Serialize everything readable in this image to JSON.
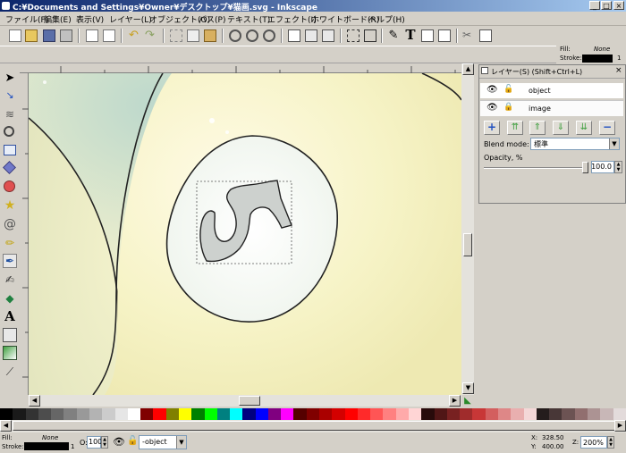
{
  "window": {
    "title": "C:¥Documents and Settings¥Owner¥デスクトップ¥猫画.svg - Inkscape"
  },
  "menu": [
    {
      "label": "ファイル(F)"
    },
    {
      "label": "編集(E)"
    },
    {
      "label": "表示(V)"
    },
    {
      "label": "レイヤー(L)"
    },
    {
      "label": "オブジェクト(O)"
    },
    {
      "label": "パス(P)"
    },
    {
      "label": "テキスト(T)"
    },
    {
      "label": "エフェクト(I)"
    },
    {
      "label": "ホワイトボード(R)"
    },
    {
      "label": "ヘルプ(H)"
    }
  ],
  "top_style": {
    "fill_label": "Fill:",
    "fill_value": "None",
    "stroke_label": "Stroke:",
    "stroke_width": "1"
  },
  "layers_panel": {
    "title": "レイヤー(S) (Shift+Ctrl+L)",
    "layers": [
      {
        "name": "object"
      },
      {
        "name": "image"
      }
    ],
    "blend_label": "Blend mode:",
    "blend_value": "標準",
    "opacity_label": "Opacity, %",
    "opacity_value": "100.0"
  },
  "palette": [
    "#000000",
    "#1a1a1a",
    "#333333",
    "#4d4d4d",
    "#666666",
    "#808080",
    "#999999",
    "#b3b3b3",
    "#cccccc",
    "#e6e6e6",
    "#ffffff",
    "#800000",
    "#ff0000",
    "#808000",
    "#ffff00",
    "#008000",
    "#00ff00",
    "#008080",
    "#00ffff",
    "#000080",
    "#0000ff",
    "#800080",
    "#ff00ff",
    "#550000",
    "#800000",
    "#aa0000",
    "#d40000",
    "#ff0000",
    "#ff2a2a",
    "#ff5555",
    "#ff8080",
    "#ffaaaa",
    "#ffd5d5",
    "#280b0b",
    "#501616",
    "#782121",
    "#a02c2c",
    "#c83737",
    "#d35f5f",
    "#de8787",
    "#e9afaf",
    "#f4d7d7",
    "#241c1c",
    "#483737",
    "#6c5353",
    "#916f6f",
    "#ac9393",
    "#c8b7b7",
    "#e3dbdb"
  ],
  "status": {
    "fill_label": "Fill:",
    "fill_value": "None",
    "stroke_label": "Stroke:",
    "stroke_width": "1",
    "opacity_label": "O:",
    "opacity_value": "100",
    "layer_value": "-object",
    "x_label": "X:",
    "x_value": "328.50",
    "y_label": "Y:",
    "y_value": "400.00",
    "zoom_label": "Z:",
    "zoom_value": "200%"
  },
  "colors": {
    "titlebar_start": "#0a246a",
    "titlebar_end": "#a6caf0",
    "ball_fill": "#f7f4c8",
    "number_disc": "#f4f6ec",
    "glyph_fill": "#cfd3d0"
  }
}
